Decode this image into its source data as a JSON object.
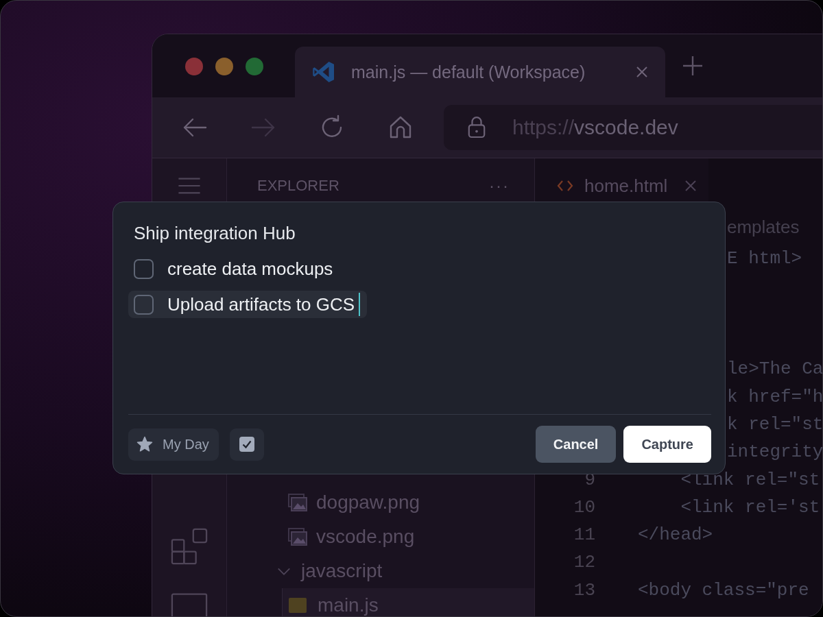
{
  "browser": {
    "tab_title": "main.js — default (Workspace)",
    "url": {
      "scheme": "https://",
      "host": "vscode.dev"
    }
  },
  "explorer": {
    "title": "EXPLORER",
    "more": "···",
    "items": [
      {
        "kind": "image",
        "name": "dogpaw.png"
      },
      {
        "kind": "image",
        "name": "vscode.png"
      },
      {
        "kind": "folder",
        "name": "javascript",
        "expanded": true,
        "children": [
          {
            "kind": "script",
            "name": "main.js",
            "selected": true
          }
        ]
      }
    ]
  },
  "editor": {
    "tab_title": "home.html",
    "breadcrumb": "emplates",
    "lines": [
      {
        "kind": "fragment",
        "text": "E html>"
      },
      {
        "kind": "fragment"
      },
      {
        "kind": "fragment"
      },
      {
        "kind": "fragment"
      },
      {
        "kind": "fragment",
        "text": "le>The Ca"
      },
      {
        "kind": "fragment",
        "text": "k href=\"h"
      },
      {
        "kind": "fragment",
        "text": "k rel=\"st"
      },
      {
        "kind": "fragment",
        "text": "integrity"
      },
      {
        "kind": "line",
        "number": "9",
        "text": "    <link rel=\"st"
      },
      {
        "kind": "line",
        "number": "10",
        "text": "    <link rel='st"
      },
      {
        "kind": "line",
        "number": "11",
        "text": "</head>"
      },
      {
        "kind": "line",
        "number": "12"
      },
      {
        "kind": "line",
        "number": "13",
        "text": "<body class=\"pre"
      }
    ]
  },
  "capture_dialog": {
    "title": "Ship integration Hub",
    "tasks": [
      {
        "text": "create data mockups",
        "checked": false,
        "focused": false
      },
      {
        "text": "Upload artifacts to GCS",
        "checked": false,
        "focused": true
      }
    ],
    "my_day": {
      "label": "My Day"
    },
    "task_toggle": {
      "checked": true
    },
    "buttons": [
      {
        "label": "Cancel",
        "kind": "secondary"
      },
      {
        "label": "Capture",
        "kind": "primary"
      }
    ]
  }
}
